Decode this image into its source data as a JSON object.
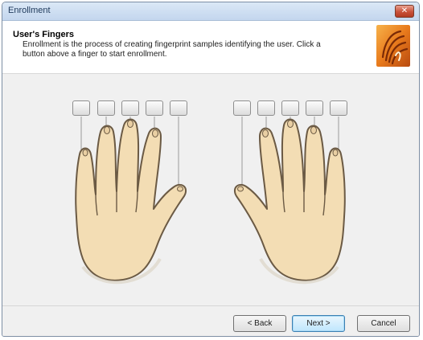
{
  "window": {
    "title": "Enrollment",
    "close_symbol": "✕"
  },
  "header": {
    "title": "User's Fingers",
    "description": "Enrollment is the process of creating fingerprint samples identifying the user. Click a button above a finger to start enrollment."
  },
  "icons": {
    "logo": "fingerprint-logo-icon",
    "close": "close-icon"
  },
  "colors": {
    "skin": "#f3ddb4",
    "skin_outline": "#6b5a44",
    "logo_orange": "#e87a1c",
    "default_button_border": "#3c7fb1"
  },
  "left_hand_buttons": [
    "little-finger",
    "ring-finger",
    "middle-finger",
    "index-finger",
    "thumb"
  ],
  "right_hand_buttons": [
    "thumb",
    "index-finger",
    "middle-finger",
    "ring-finger",
    "little-finger"
  ],
  "footer": {
    "back_label": "< Back",
    "next_label": "Next >",
    "cancel_label": "Cancel"
  }
}
